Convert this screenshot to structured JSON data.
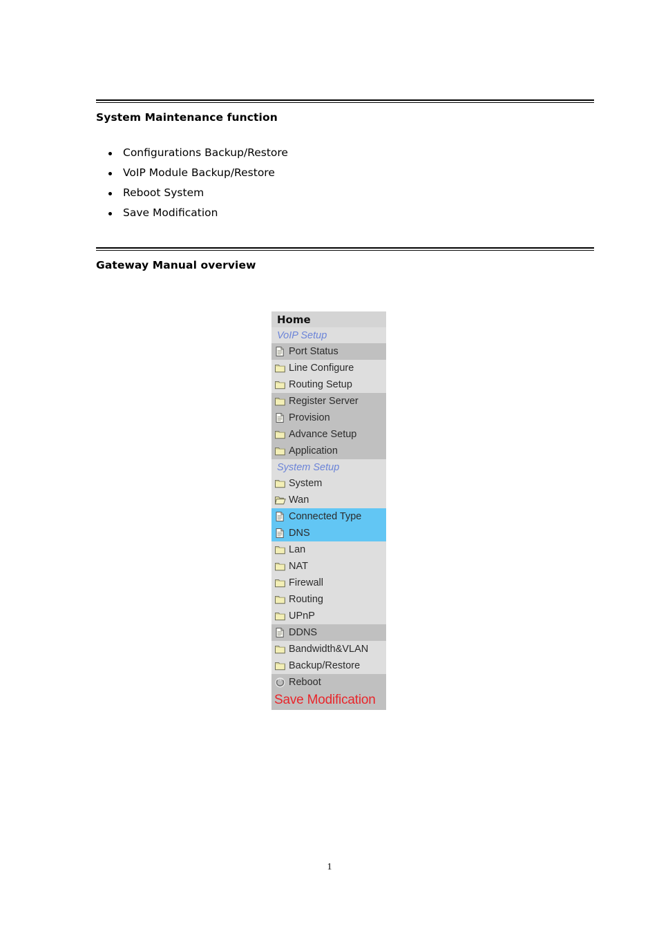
{
  "document": {
    "sections": [
      {
        "title": "System Maintenance function",
        "bullets": [
          "Configurations Backup/Restore",
          "VoIP Module Backup/Restore",
          "Reboot System",
          "Save Modification"
        ]
      },
      {
        "title": "Gateway Manual overview",
        "bullets": []
      }
    ],
    "page_number": "1"
  },
  "gateway_menu": {
    "header": "Home",
    "colors": {
      "selected_background": "#62c6f4",
      "group_label": "#6b84d8",
      "save_modification": "#e8262b",
      "folder_icon": "#f2eeb3",
      "panel_background": "#d4d4d4"
    },
    "items": [
      {
        "label": "Home",
        "icon": "none",
        "type": "header",
        "shade": "mid",
        "selected": false
      },
      {
        "label": "VoIP Setup",
        "icon": "none",
        "type": "group",
        "shade": "light",
        "selected": false
      },
      {
        "label": "Port Status",
        "icon": "page-icon",
        "type": "item",
        "shade": "dark",
        "selected": false
      },
      {
        "label": "Line Configure",
        "icon": "folder-icon",
        "type": "item",
        "shade": "light",
        "selected": false
      },
      {
        "label": "Routing Setup",
        "icon": "folder-icon",
        "type": "item",
        "shade": "light",
        "selected": false
      },
      {
        "label": "Register Server",
        "icon": "folder-icon",
        "type": "item",
        "shade": "dark",
        "selected": false
      },
      {
        "label": "Provision",
        "icon": "page-icon",
        "type": "item",
        "shade": "dark",
        "selected": false
      },
      {
        "label": "Advance Setup",
        "icon": "folder-icon",
        "type": "item",
        "shade": "dark",
        "selected": false
      },
      {
        "label": "Application",
        "icon": "folder-icon",
        "type": "item",
        "shade": "dark",
        "selected": false
      },
      {
        "label": "System Setup",
        "icon": "none",
        "type": "group",
        "shade": "light",
        "selected": false
      },
      {
        "label": "System",
        "icon": "folder-icon",
        "type": "item",
        "shade": "light",
        "selected": false
      },
      {
        "label": "Wan",
        "icon": "folder-open-icon",
        "type": "item",
        "shade": "light",
        "selected": false
      },
      {
        "label": "Connected Type",
        "icon": "page-icon",
        "type": "item",
        "shade": "sel",
        "selected": true
      },
      {
        "label": "DNS",
        "icon": "page-icon",
        "type": "item",
        "shade": "sel",
        "selected": true
      },
      {
        "label": "Lan",
        "icon": "folder-icon",
        "type": "item",
        "shade": "light",
        "selected": false
      },
      {
        "label": "NAT",
        "icon": "folder-icon",
        "type": "item",
        "shade": "light",
        "selected": false
      },
      {
        "label": "Firewall",
        "icon": "folder-icon",
        "type": "item",
        "shade": "light",
        "selected": false
      },
      {
        "label": "Routing",
        "icon": "folder-icon",
        "type": "item",
        "shade": "light",
        "selected": false
      },
      {
        "label": "UPnP",
        "icon": "folder-icon",
        "type": "item",
        "shade": "light",
        "selected": false
      },
      {
        "label": "DDNS",
        "icon": "page-icon",
        "type": "item",
        "shade": "dark",
        "selected": false
      },
      {
        "label": "Bandwidth&VLAN",
        "icon": "folder-icon",
        "type": "item",
        "shade": "light",
        "selected": false
      },
      {
        "label": "Backup/Restore",
        "icon": "folder-icon",
        "type": "item",
        "shade": "light",
        "selected": false
      },
      {
        "label": "Reboot",
        "icon": "power-icon",
        "type": "item",
        "shade": "dark",
        "selected": false
      },
      {
        "label": "Save Modification",
        "icon": "none",
        "type": "save",
        "shade": "dark",
        "selected": false
      }
    ]
  }
}
